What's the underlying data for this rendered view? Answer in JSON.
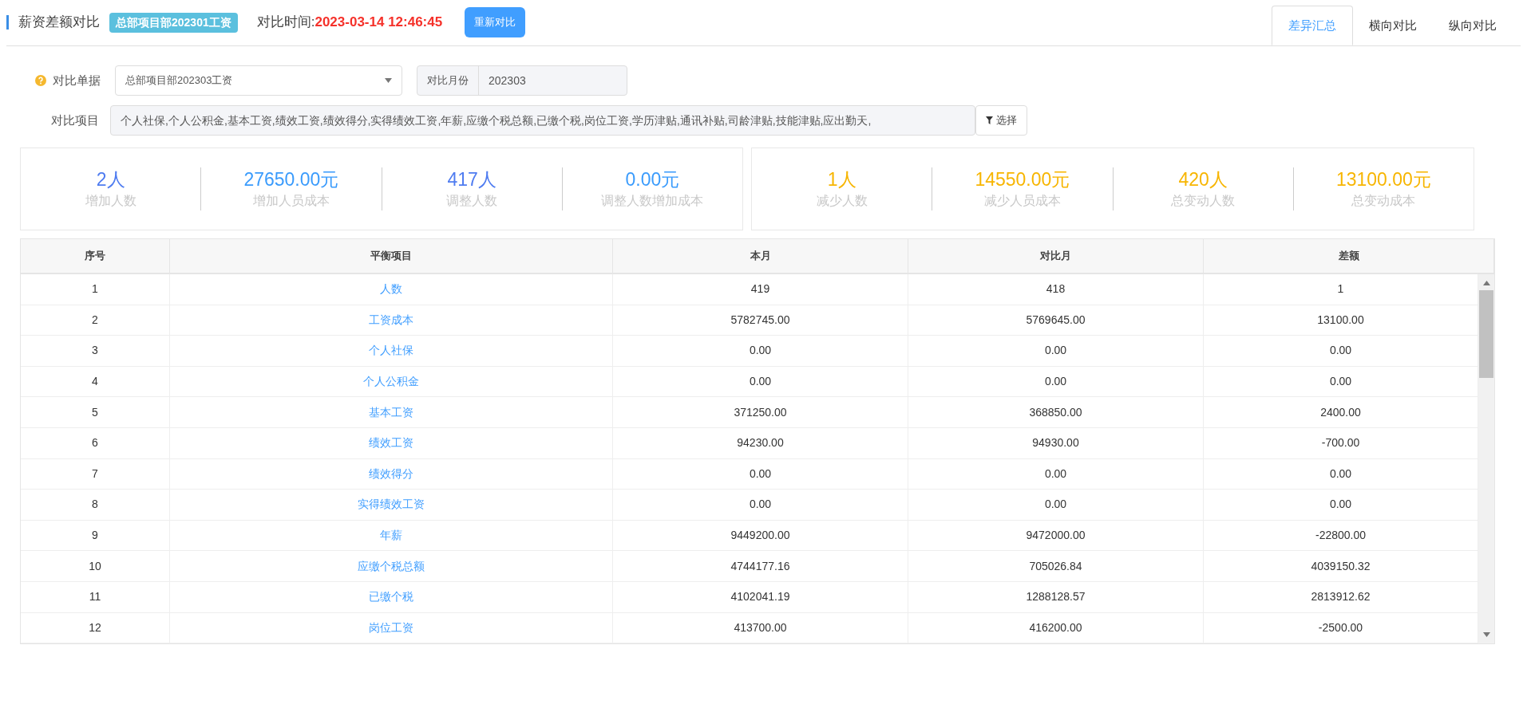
{
  "header": {
    "title": "薪资差额对比",
    "badge": "总部项目部202301工资",
    "time_label": "对比时间:",
    "time_value": "2023-03-14 12:46:45",
    "recompare_button": "重新对比"
  },
  "tabs": [
    {
      "label": "差异汇总",
      "selected": true
    },
    {
      "label": "横向对比",
      "selected": false
    },
    {
      "label": "纵向对比",
      "selected": false
    }
  ],
  "filters": {
    "document_label": "对比单据",
    "document_value": "总部项目部202303工资",
    "month_label": "对比月份",
    "month_value": "202303",
    "items_label": "对比项目",
    "items_value": "个人社保,个人公积金,基本工资,绩效工资,绩效得分,实得绩效工资,年薪,应缴个税总额,已缴个税,岗位工资,学历津贴,通讯补贴,司龄津贴,技能津贴,应出勤天,",
    "select_button": "选择"
  },
  "stat_groups": [
    [
      {
        "value": "2人",
        "label": "增加人数",
        "color": "#4f7cf0"
      },
      {
        "value": "27650.00元",
        "label": "增加人员成本",
        "color": "#3a9bfc"
      },
      {
        "value": "417人",
        "label": "调整人数",
        "color": "#4f7cf0"
      },
      {
        "value": "0.00元",
        "label": "调整人数增加成本",
        "color": "#3a9bfc"
      }
    ],
    [
      {
        "value": "1人",
        "label": "减少人数",
        "color": "#f7b500"
      },
      {
        "value": "14550.00元",
        "label": "减少人员成本",
        "color": "#f7b500"
      },
      {
        "value": "420人",
        "label": "总变动人数",
        "color": "#f7b500"
      },
      {
        "value": "13100.00元",
        "label": "总变动成本",
        "color": "#f7b500"
      }
    ]
  ],
  "table": {
    "columns": [
      "序号",
      "平衡项目",
      "本月",
      "对比月",
      "差额"
    ],
    "rows": [
      [
        "1",
        "人数",
        "419",
        "418",
        "1"
      ],
      [
        "2",
        "工资成本",
        "5782745.00",
        "5769645.00",
        "13100.00"
      ],
      [
        "3",
        "个人社保",
        "0.00",
        "0.00",
        "0.00"
      ],
      [
        "4",
        "个人公积金",
        "0.00",
        "0.00",
        "0.00"
      ],
      [
        "5",
        "基本工资",
        "371250.00",
        "368850.00",
        "2400.00"
      ],
      [
        "6",
        "绩效工资",
        "94230.00",
        "94930.00",
        "-700.00"
      ],
      [
        "7",
        "绩效得分",
        "0.00",
        "0.00",
        "0.00"
      ],
      [
        "8",
        "实得绩效工资",
        "0.00",
        "0.00",
        "0.00"
      ],
      [
        "9",
        "年薪",
        "9449200.00",
        "9472000.00",
        "-22800.00"
      ],
      [
        "10",
        "应缴个税总额",
        "4744177.16",
        "705026.84",
        "4039150.32"
      ],
      [
        "11",
        "已缴个税",
        "4102041.19",
        "1288128.57",
        "2813912.62"
      ],
      [
        "12",
        "岗位工资",
        "413700.00",
        "416200.00",
        "-2500.00"
      ]
    ]
  }
}
